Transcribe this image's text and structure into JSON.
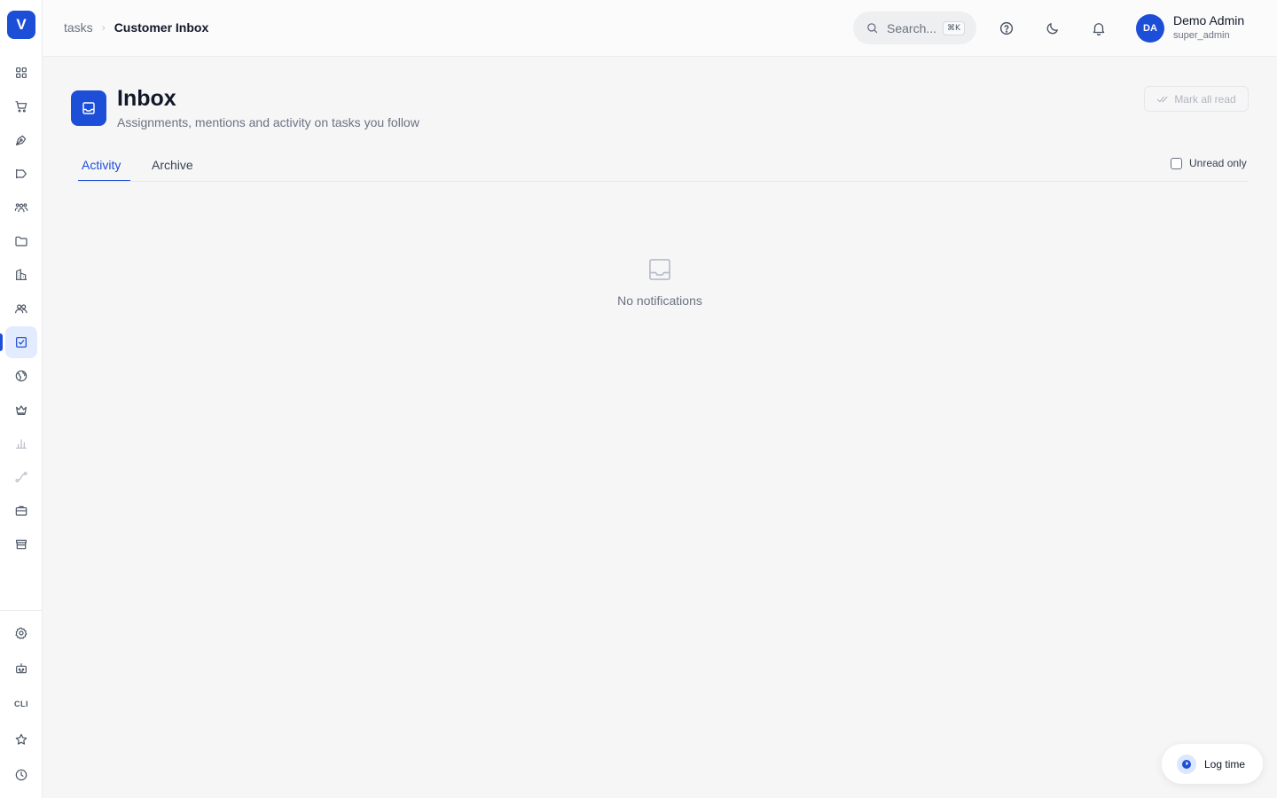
{
  "app": {
    "logo_letter": "V"
  },
  "breadcrumb": {
    "parent": "tasks",
    "current": "Customer Inbox"
  },
  "search": {
    "placeholder": "Search...",
    "shortcut": "⌘K"
  },
  "user": {
    "initials": "DA",
    "name": "Demo Admin",
    "role": "super_admin"
  },
  "sidebar": {
    "items": [
      {
        "icon": "dashboard-grid-icon"
      },
      {
        "icon": "shopping-cart-icon"
      },
      {
        "icon": "pen-tool-icon"
      },
      {
        "icon": "megaphone-icon"
      },
      {
        "icon": "users-group-icon"
      },
      {
        "icon": "folder-icon"
      },
      {
        "icon": "buildings-icon"
      },
      {
        "icon": "contacts-icon"
      },
      {
        "icon": "tasks-checkbox-icon",
        "active": true
      },
      {
        "icon": "globe-icon"
      },
      {
        "icon": "crown-icon"
      },
      {
        "icon": "bar-chart-icon",
        "faded": true
      },
      {
        "icon": "route-icon",
        "faded": true
      },
      {
        "icon": "briefcase-icon"
      },
      {
        "icon": "store-icon"
      }
    ],
    "bottom_items": [
      {
        "icon": "settings-gear-icon"
      },
      {
        "icon": "robot-icon"
      },
      {
        "label": "CLI"
      },
      {
        "icon": "star-icon"
      },
      {
        "icon": "clock-icon"
      }
    ]
  },
  "page": {
    "title": "Inbox",
    "subtitle": "Assignments, mentions and activity on tasks you follow",
    "mark_all_read": "Mark all read"
  },
  "tabs": [
    {
      "label": "Activity",
      "active": true
    },
    {
      "label": "Archive",
      "active": false
    }
  ],
  "filter": {
    "unread_only_label": "Unread only",
    "unread_only_checked": false
  },
  "empty_state": {
    "message": "No notifications"
  },
  "log_time": {
    "label": "Log time"
  },
  "colors": {
    "accent": "#1d4ed8",
    "background": "#f6f6f7",
    "muted_text": "#6b7280"
  }
}
